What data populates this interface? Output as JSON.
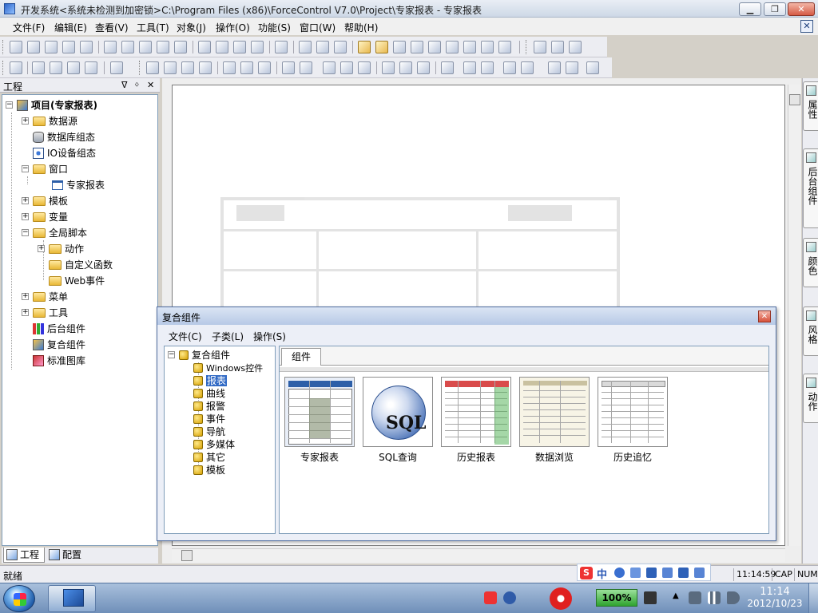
{
  "window": {
    "title": "开发系统<系统未检测到加密锁>C:\\Program Files (x86)\\ForceControl V7.0\\Project\\专家报表 - 专家报表",
    "minimize": "▁",
    "restore": "❐",
    "close": "✕"
  },
  "menubar": {
    "items": [
      "文件(F)",
      "编辑(E)",
      "查看(V)",
      "工具(T)",
      "对象(J)",
      "操作(O)",
      "功能(S)",
      "窗口(W)",
      "帮助(H)"
    ],
    "mdi_close": "✕"
  },
  "project_panel": {
    "title": "工程",
    "pin": "ᐁ",
    "close": "✕",
    "root": "项目(专家报表)",
    "nodes": [
      "数据源",
      "数据库组态",
      "IO设备组态",
      "窗口",
      "专家报表",
      "模板",
      "变量",
      "全局脚本",
      "动作",
      "自定义函数",
      "Web事件",
      "菜单",
      "工具",
      "后台组件",
      "复合组件",
      "标准图库"
    ],
    "tabs": [
      "工程",
      "配置"
    ]
  },
  "right_dock": {
    "tabs": [
      "属性",
      "后台组件",
      "颜色",
      "风格",
      "动作"
    ]
  },
  "composite_dialog": {
    "title": "复合组件",
    "close": "✕",
    "menu": [
      "文件(C)",
      "子类(L)",
      "操作(S)"
    ],
    "tree_root": "复合组件",
    "tree_items": [
      "Windows控件",
      "报表",
      "曲线",
      "报警",
      "事件",
      "导航",
      "多媒体",
      "其它",
      "模板"
    ],
    "selected_item": "报表",
    "tab": "组件",
    "components": [
      "专家报表",
      "SQL查询",
      "历史报表",
      "数据浏览",
      "历史追忆"
    ],
    "sql_label": "SQL"
  },
  "statusbar": {
    "status": "就绪",
    "time": "11:14:59",
    "caps": "CAP",
    "num": "NUM"
  },
  "ime": {
    "logo": "S",
    "mode": "中"
  },
  "taskbar": {
    "battery": "100%",
    "clock_time": "11:14",
    "clock_date": "2012/10/23"
  }
}
